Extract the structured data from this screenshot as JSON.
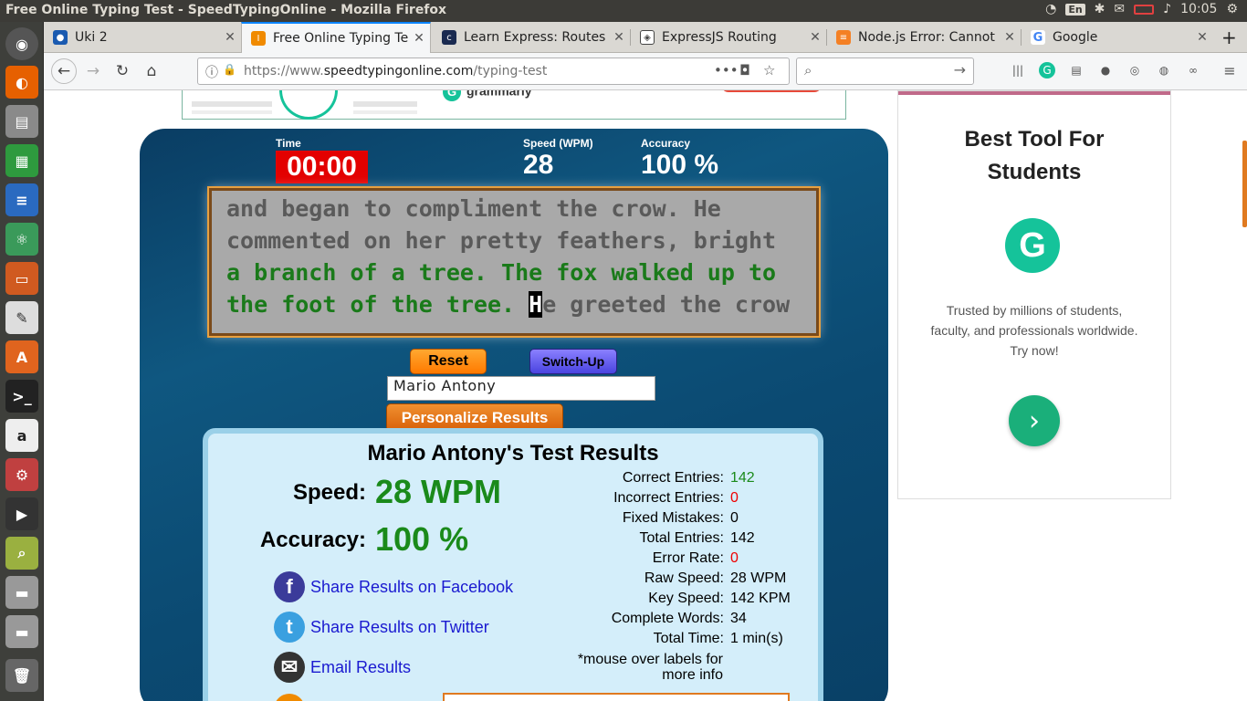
{
  "os": {
    "window_title": "Free Online Typing Test - SpeedTypingOnline - Mozilla Firefox",
    "keyboard": "En",
    "clock": "10:05"
  },
  "tabs": [
    {
      "label": "Uki 2",
      "icon": "user-icon"
    },
    {
      "label": "Free Online Typing Test",
      "icon": "typing-site-icon"
    },
    {
      "label": "Learn Express: Routes",
      "icon": "codecademy-icon"
    },
    {
      "label": "ExpressJS Routing",
      "icon": "tutorialspoint-icon"
    },
    {
      "label": "Node.js Error: Cannot",
      "icon": "stackoverflow-icon"
    },
    {
      "label": "Google",
      "icon": "google-icon"
    }
  ],
  "urlbar": {
    "prefix": "https://www.",
    "domain": "speedtypingonline.com",
    "path": "/typing-test"
  },
  "ad_top": {
    "brand": "grammarly"
  },
  "test": {
    "time_label": "Time",
    "time_value": "00:00",
    "speed_label": "Speed (WPM)",
    "speed_value": "28",
    "accuracy_label": "Accuracy",
    "accuracy_value": "100 %",
    "lines": [
      {
        "untyped": "and began to compliment the crow. He"
      },
      {
        "untyped": "commented on her pretty feathers, bright"
      },
      {
        "typed": "a branch of a tree. The fox walked up to"
      },
      {
        "typed": "the foot of the tree. ",
        "cursor": "H",
        "untyped": "e greeted the crow"
      }
    ],
    "reset_label": "Reset",
    "switch_label": "Switch-Up",
    "name_value": "Mario Antony",
    "personalize_label": "Personalize Results"
  },
  "results": {
    "title": "Mario Antony's Test Results",
    "speed_label": "Speed:",
    "speed_value": "28 WPM",
    "accuracy_label": "Accuracy:",
    "accuracy_value": "100 %",
    "share": [
      {
        "label": "Share Results on Facebook",
        "icon": "facebook-icon",
        "color": "#3b3b9a"
      },
      {
        "label": "Share Results on Twitter",
        "icon": "twitter-icon",
        "color": "#3aa0e0"
      },
      {
        "label": "Email Results",
        "icon": "email-icon",
        "color": "#333333"
      }
    ],
    "stats": [
      {
        "key": "Correct Entries:",
        "value": "142",
        "color": "green"
      },
      {
        "key": "Incorrect Entries:",
        "value": "0",
        "color": "red"
      },
      {
        "key": "Fixed Mistakes:",
        "value": "0",
        "color": ""
      },
      {
        "key": "Total Entries:",
        "value": "142",
        "color": ""
      },
      {
        "key": "Error Rate:",
        "value": "0",
        "color": "red"
      },
      {
        "key": "Raw Speed:",
        "value": "28 WPM",
        "color": ""
      },
      {
        "key": "Key Speed:",
        "value": "142 KPM",
        "color": ""
      },
      {
        "key": "Complete Words:",
        "value": "34",
        "color": ""
      },
      {
        "key": "Total Time:",
        "value": "1 min(s)",
        "color": ""
      }
    ],
    "note_line1": "*mouse over labels for",
    "note_line2": "more info"
  },
  "side_ad": {
    "heading_line1": "Best Tool For",
    "heading_line2": "Students",
    "text_line1": "Trusted by millions of students,",
    "text_line2": "faculty, and professionals worldwide.",
    "text_line3": "Try now!"
  }
}
